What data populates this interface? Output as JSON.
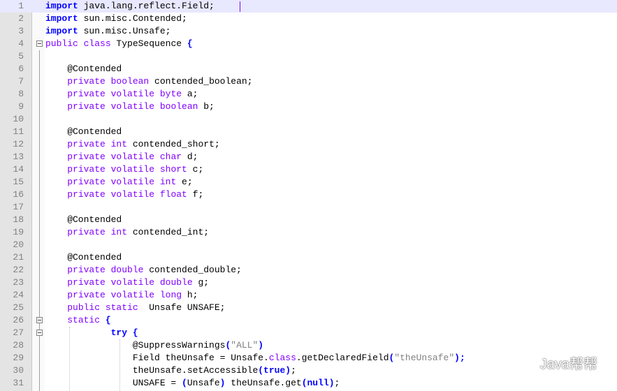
{
  "lines": [
    {
      "n": "1",
      "parts": [
        {
          "t": "import",
          "c": "kw"
        },
        {
          "t": " java.lang.reflect.Field;"
        }
      ]
    },
    {
      "n": "2",
      "parts": [
        {
          "t": "import",
          "c": "kw"
        },
        {
          "t": " sun.misc.Contended;"
        }
      ]
    },
    {
      "n": "3",
      "parts": [
        {
          "t": "import",
          "c": "kw"
        },
        {
          "t": " sun.misc.Unsafe;"
        }
      ]
    },
    {
      "n": "4",
      "parts": [
        {
          "t": "public class",
          "c": "kw2"
        },
        {
          "t": " TypeSequence "
        },
        {
          "t": "{",
          "c": "kw"
        }
      ]
    },
    {
      "n": "5",
      "parts": []
    },
    {
      "n": "6",
      "parts": [
        {
          "t": "    @Contended"
        }
      ]
    },
    {
      "n": "7",
      "parts": [
        {
          "t": "    "
        },
        {
          "t": "private boolean",
          "c": "kw2"
        },
        {
          "t": " contended_boolean;"
        }
      ]
    },
    {
      "n": "8",
      "parts": [
        {
          "t": "    "
        },
        {
          "t": "private volatile byte",
          "c": "kw2"
        },
        {
          "t": " a;"
        }
      ]
    },
    {
      "n": "9",
      "parts": [
        {
          "t": "    "
        },
        {
          "t": "private volatile boolean",
          "c": "kw2"
        },
        {
          "t": " b;"
        }
      ]
    },
    {
      "n": "10",
      "parts": []
    },
    {
      "n": "11",
      "parts": [
        {
          "t": "    @Contended"
        }
      ]
    },
    {
      "n": "12",
      "parts": [
        {
          "t": "    "
        },
        {
          "t": "private int",
          "c": "kw2"
        },
        {
          "t": " contended_short;"
        }
      ]
    },
    {
      "n": "13",
      "parts": [
        {
          "t": "    "
        },
        {
          "t": "private volatile char",
          "c": "kw2"
        },
        {
          "t": " d;"
        }
      ]
    },
    {
      "n": "14",
      "parts": [
        {
          "t": "    "
        },
        {
          "t": "private volatile short",
          "c": "kw2"
        },
        {
          "t": " c;"
        }
      ]
    },
    {
      "n": "15",
      "parts": [
        {
          "t": "    "
        },
        {
          "t": "private volatile int",
          "c": "kw2"
        },
        {
          "t": " e;"
        }
      ]
    },
    {
      "n": "16",
      "parts": [
        {
          "t": "    "
        },
        {
          "t": "private volatile float",
          "c": "kw2"
        },
        {
          "t": " f;"
        }
      ]
    },
    {
      "n": "17",
      "parts": []
    },
    {
      "n": "18",
      "parts": [
        {
          "t": "    @Contended"
        }
      ]
    },
    {
      "n": "19",
      "parts": [
        {
          "t": "    "
        },
        {
          "t": "private int",
          "c": "kw2"
        },
        {
          "t": " contended_int;"
        }
      ]
    },
    {
      "n": "20",
      "parts": []
    },
    {
      "n": "21",
      "parts": [
        {
          "t": "    @Contended"
        }
      ]
    },
    {
      "n": "22",
      "parts": [
        {
          "t": "    "
        },
        {
          "t": "private double",
          "c": "kw2"
        },
        {
          "t": " contended_double;"
        }
      ]
    },
    {
      "n": "23",
      "parts": [
        {
          "t": "    "
        },
        {
          "t": "private volatile double",
          "c": "kw2"
        },
        {
          "t": " g;"
        }
      ]
    },
    {
      "n": "24",
      "parts": [
        {
          "t": "    "
        },
        {
          "t": "private volatile long",
          "c": "kw2"
        },
        {
          "t": " h;"
        }
      ]
    },
    {
      "n": "25",
      "parts": [
        {
          "t": "    "
        },
        {
          "t": "public static",
          "c": "kw2"
        },
        {
          "t": "  Unsafe UNSAFE;"
        }
      ]
    },
    {
      "n": "26",
      "parts": [
        {
          "t": "    "
        },
        {
          "t": "static",
          "c": "kw2"
        },
        {
          "t": " "
        },
        {
          "t": "{",
          "c": "kw"
        }
      ]
    },
    {
      "n": "27",
      "parts": [
        {
          "t": "            "
        },
        {
          "t": "try",
          "c": "kw"
        },
        {
          "t": " "
        },
        {
          "t": "{",
          "c": "kw"
        }
      ]
    },
    {
      "n": "28",
      "parts": [
        {
          "t": "                @SuppressWarnings"
        },
        {
          "t": "(",
          "c": "kw"
        },
        {
          "t": "\"ALL\"",
          "c": "str"
        },
        {
          "t": ")",
          "c": "kw"
        }
      ]
    },
    {
      "n": "29",
      "parts": [
        {
          "t": "                Field theUnsafe = Unsafe."
        },
        {
          "t": "class",
          "c": "kw2"
        },
        {
          "t": ".getDeclaredField"
        },
        {
          "t": "(",
          "c": "kw"
        },
        {
          "t": "\"theUnsafe\"",
          "c": "str"
        },
        {
          "t": ");",
          "c": "kw"
        }
      ]
    },
    {
      "n": "30",
      "parts": [
        {
          "t": "                theUnsafe.setAccessible"
        },
        {
          "t": "(true)",
          "c": "kw"
        },
        {
          "t": ";"
        }
      ]
    },
    {
      "n": "31",
      "parts": [
        {
          "t": "                UNSAFE = "
        },
        {
          "t": "(",
          "c": "kw"
        },
        {
          "t": "Unsafe"
        },
        {
          "t": ")",
          "c": "kw"
        },
        {
          "t": " theUnsafe.get"
        },
        {
          "t": "(null)",
          "c": "kw"
        },
        {
          "t": ";"
        }
      ]
    }
  ],
  "folds": [
    "4",
    "26",
    "27"
  ],
  "watermark": {
    "text": "Java帮帮",
    "icon": "wechat-icon"
  },
  "colors": {
    "keyword": "#0000ff",
    "type_keyword": "#8000ff",
    "string": "#808080",
    "gutter": "#e4e4e4",
    "current_line": "#e8e8ff"
  }
}
